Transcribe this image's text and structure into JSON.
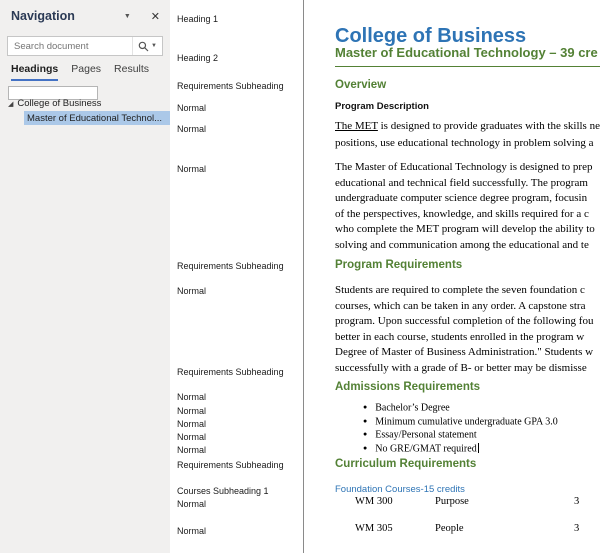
{
  "colors": {
    "heading_blue": "#2e74b5",
    "heading_green": "#538135",
    "nav_selection": "#abc8e8",
    "nav_background": "#f1f0ef",
    "tab_accent": "#4472c4"
  },
  "navigation_pane": {
    "title": "Navigation",
    "options_icon": "▼",
    "close_icon": "✕",
    "search": {
      "placeholder": "Search document",
      "dropdown_icon": "▼"
    },
    "tabs": [
      "Headings",
      "Pages",
      "Results"
    ],
    "active_tab": "Headings",
    "expand_icon": "◢",
    "tree": [
      {
        "label": "College of Business",
        "selected": false
      },
      {
        "label": "Master of Educational Technol...",
        "selected": true
      }
    ]
  },
  "style_area": {
    "entries": [
      "Heading 1",
      "Heading 2",
      "Requirements Subheading",
      "Normal",
      "Normal",
      "Normal",
      "Requirements Subheading",
      "Normal",
      "Requirements Subheading",
      "Normal",
      "Normal",
      "Normal",
      "Normal",
      "Normal",
      "Requirements Subheading",
      "Courses Subheading 1",
      "Normal",
      "Normal"
    ]
  },
  "document": {
    "title": "College of Business",
    "program_title": "Master of Educational Technology – 39 cre",
    "overview_heading": "Overview",
    "program_description_label": "Program Description",
    "para1_underlined": "The MET",
    "para1_line1_rest": " is designed to provide graduates with the skills nee",
    "para1_line2": "positions, use educational technology in problem solving a",
    "para2_lines": [
      "The Master of Educational Technology is designed to prep",
      "educational and technical field successfully. The program",
      "undergraduate computer science degree program, focusin",
      "of the perspectives, knowledge, and skills required for a c",
      "who complete the MET program will develop the ability to",
      "solving and communication among the educational and te"
    ],
    "program_requirements_heading": "Program Requirements",
    "para3_lines": [
      "Students are required to complete the seven foundation c",
      "courses, which can be taken in any order. A capstone stra",
      "program. Upon successful completion of the following fou",
      "better in each course, students enrolled in the program w",
      "Degree of Master of Business Administration.\" Students w",
      "successfully with a grade of B- or better may be dismisse"
    ],
    "admissions_heading": "Admissions Requirements",
    "bullet_glyph": "●",
    "admissions_bullets": [
      "Bachelor’s Degree",
      "Minimum cumulative undergraduate GPA 3.0",
      "Essay/Personal statement",
      "No GRE/GMAT required"
    ],
    "curriculum_heading": "Curriculum Requirements",
    "foundation_label": "Foundation Courses-15 credits",
    "course_rows": [
      {
        "code": "WM 300",
        "title": "Purpose",
        "credits": "3"
      },
      {
        "code": "WM 305",
        "title": "People",
        "credits": "3"
      }
    ]
  }
}
